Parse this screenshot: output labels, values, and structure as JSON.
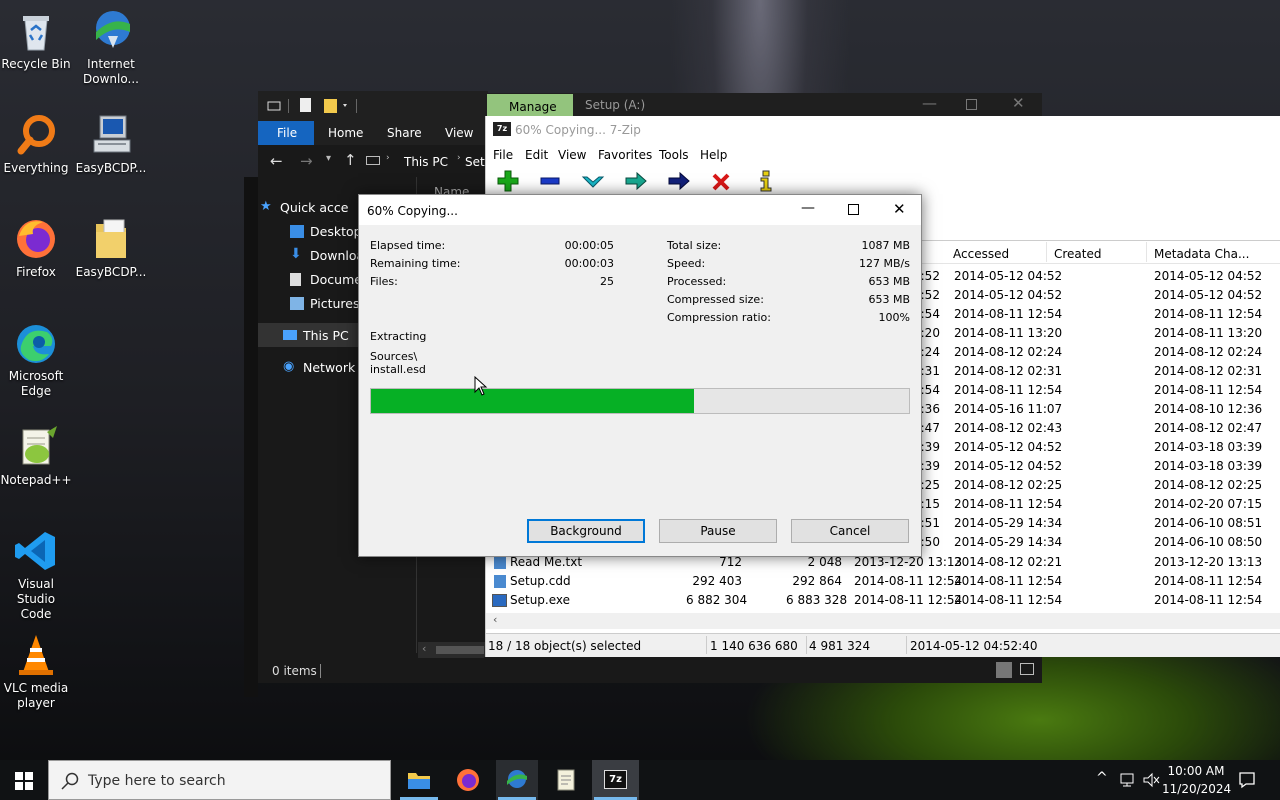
{
  "desktop": {
    "icons": [
      {
        "label": "Recycle Bin",
        "icon": "recycle-bin-icon"
      },
      {
        "label": "Internet Downlo...",
        "icon": "internet-download-manager-icon"
      },
      {
        "label": "Everything",
        "icon": "everything-search-icon"
      },
      {
        "label": "EasyBCDP...",
        "icon": "easybcd-icon"
      },
      {
        "label": "Firefox",
        "icon": "firefox-icon"
      },
      {
        "label": "EasyBCDP...",
        "icon": "folder-icon"
      },
      {
        "label": "Microsoft Edge",
        "icon": "edge-icon"
      },
      {
        "label": "Notepad++",
        "icon": "notepad-plus-plus-icon"
      },
      {
        "label": "Visual Studio Code",
        "icon": "vscode-icon"
      },
      {
        "label": "VLC media player",
        "icon": "vlc-icon"
      }
    ]
  },
  "explorer": {
    "ribbon": [
      "File",
      "Home",
      "Share",
      "View"
    ],
    "path": "This PC",
    "path_next": "Setu",
    "column_name": "Name",
    "nav": [
      "Quick acce",
      "Desktop",
      "Downloa",
      "Docume",
      "Pictures",
      "This PC",
      "Network"
    ],
    "status": "0 items"
  },
  "sevenzip_window": {
    "manage_tab": "Manage",
    "manage_title": "Setup (A:)",
    "title": "60% Copying... 7-Zip",
    "menu": [
      "File",
      "Edit",
      "View",
      "Favorites",
      "Tools",
      "Help"
    ],
    "toolbar": [
      "add-icon",
      "extract-icon",
      "test-icon",
      "copy-icon",
      "move-icon",
      "delete-icon",
      "info-icon"
    ],
    "columns": {
      "accessed": "Accessed",
      "created": "Created",
      "metadata": "Metadata Cha..."
    },
    "partial_rows": [
      {
        "mod": "4:52",
        "acc": "2014-05-12 04:52",
        "meta": "2014-05-12 04:52"
      },
      {
        "mod": "4:52",
        "acc": "2014-05-12 04:52",
        "meta": "2014-05-12 04:52"
      },
      {
        "mod": "2:54",
        "acc": "2014-08-11 12:54",
        "meta": "2014-08-11 12:54"
      },
      {
        "mod": "3:20",
        "acc": "2014-08-11 13:20",
        "meta": "2014-08-11 13:20"
      },
      {
        "mod": "2:24",
        "acc": "2014-08-12 02:24",
        "meta": "2014-08-12 02:24"
      },
      {
        "mod": "2:31",
        "acc": "2014-08-12 02:31",
        "meta": "2014-08-12 02:31"
      },
      {
        "mod": "2:54",
        "acc": "2014-08-11 12:54",
        "meta": "2014-08-11 12:54"
      },
      {
        "mod": "2:36",
        "acc": "2014-05-16 11:07",
        "meta": "2014-08-10 12:36"
      },
      {
        "mod": "2:47",
        "acc": "2014-08-12 02:43",
        "meta": "2014-08-12 02:47"
      },
      {
        "mod": "3:39",
        "acc": "2014-05-12 04:52",
        "meta": "2014-03-18 03:39"
      },
      {
        "mod": "3:39",
        "acc": "2014-05-12 04:52",
        "meta": "2014-03-18 03:39"
      },
      {
        "mod": "2:25",
        "acc": "2014-08-12 02:25",
        "meta": "2014-08-12 02:25"
      },
      {
        "mod": "7:15",
        "acc": "2014-08-11 12:54",
        "meta": "2014-02-20 07:15"
      },
      {
        "mod": "8:51",
        "acc": "2014-05-29 14:34",
        "meta": "2014-06-10 08:51"
      },
      {
        "mod": "8:50",
        "acc": "2014-05-29 14:34",
        "meta": "2014-06-10 08:50"
      }
    ],
    "files": [
      {
        "name": "Read Me.txt",
        "size": "712",
        "packed": "2 048",
        "modified": "2013-12-20 13:13",
        "accessed": "2014-08-12 02:21",
        "meta": "2013-12-20 13:13"
      },
      {
        "name": "Setup.cdd",
        "size": "292 403",
        "packed": "292 864",
        "modified": "2014-08-11 12:54",
        "accessed": "2014-08-11 12:54",
        "meta": "2014-08-11 12:54"
      },
      {
        "name": "Setup.exe",
        "size": "6 882 304",
        "packed": "6 883 328",
        "modified": "2014-08-11 12:54",
        "accessed": "2014-08-11 12:54",
        "meta": "2014-08-11 12:54"
      }
    ],
    "status": {
      "selected": "18 / 18 object(s) selected",
      "size": "1 140 636 680",
      "packed": "4 981 324",
      "date": "2014-05-12 04:52:40"
    }
  },
  "dialog": {
    "title": "60% Copying...",
    "left": [
      {
        "label": "Elapsed time:",
        "value": "00:00:05"
      },
      {
        "label": "Remaining time:",
        "value": "00:00:03"
      },
      {
        "label": "Files:",
        "value": "25"
      }
    ],
    "right": [
      {
        "label": "Total size:",
        "value": "1087 MB"
      },
      {
        "label": "Speed:",
        "value": "127 MB/s"
      },
      {
        "label": "Processed:",
        "value": "653 MB"
      },
      {
        "label": "Compressed size:",
        "value": "653 MB"
      },
      {
        "label": "Compression ratio:",
        "value": "100%"
      }
    ],
    "operation": "Extracting",
    "file_path_1": "Sources\\",
    "file_path_2": "install.esd",
    "progress": 0.6,
    "buttons": {
      "background": "Background",
      "pause": "Pause",
      "cancel": "Cancel"
    }
  },
  "taskbar": {
    "search_placeholder": "Type here to search",
    "apps": [
      "file-explorer-icon",
      "firefox-icon",
      "internet-download-manager-icon",
      "notepad-icon",
      "sevenzip-icon"
    ],
    "time": "10:00 AM",
    "date": "11/20/2024"
  }
}
